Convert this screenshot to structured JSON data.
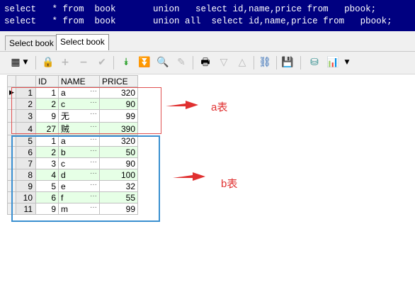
{
  "sql_editor": {
    "lines": [
      "select   * from  book       union   select id,name,price from   pbook;",
      "select   * from  book       union all  select id,name,price from   pbook;"
    ]
  },
  "tabs": [
    {
      "label": "Select book",
      "active": false
    },
    {
      "label": "Select book",
      "active": true
    }
  ],
  "toolbar": {
    "icons": [
      "grid-icon",
      "dropdown-icon",
      "lock-icon",
      "add-icon",
      "remove-icon",
      "check-icon",
      "fetch-next-icon",
      "fetch-last-icon",
      "find-icon",
      "clear-icon",
      "print-icon",
      "filter-down-icon",
      "filter-up-icon",
      "query-plan-icon",
      "save-icon",
      "database-icon",
      "chart-icon",
      "dropdown-icon"
    ]
  },
  "grid": {
    "columns": [
      "ID",
      "NAME",
      "PRICE"
    ],
    "rows": [
      {
        "rn": "1",
        "id": "1",
        "name": "a",
        "price": "320"
      },
      {
        "rn": "2",
        "id": "2",
        "name": "c",
        "price": "90"
      },
      {
        "rn": "3",
        "id": "9",
        "name": "无",
        "price": "99"
      },
      {
        "rn": "4",
        "id": "27",
        "name": "贼",
        "price": "390"
      },
      {
        "rn": "5",
        "id": "1",
        "name": "a",
        "price": "320"
      },
      {
        "rn": "6",
        "id": "2",
        "name": "b",
        "price": "50"
      },
      {
        "rn": "7",
        "id": "3",
        "name": "c",
        "price": "90"
      },
      {
        "rn": "8",
        "id": "4",
        "name": "d",
        "price": "100"
      },
      {
        "rn": "9",
        "id": "5",
        "name": "e",
        "price": "32"
      },
      {
        "rn": "10",
        "id": "6",
        "name": "f",
        "price": "55"
      },
      {
        "rn": "11",
        "id": "9",
        "name": "m",
        "price": "99"
      }
    ],
    "cell_button": "···"
  },
  "annotations": {
    "a_label": "a表",
    "b_label": "b表",
    "a_color": "#e05050",
    "b_color": "#3a8fd0"
  }
}
